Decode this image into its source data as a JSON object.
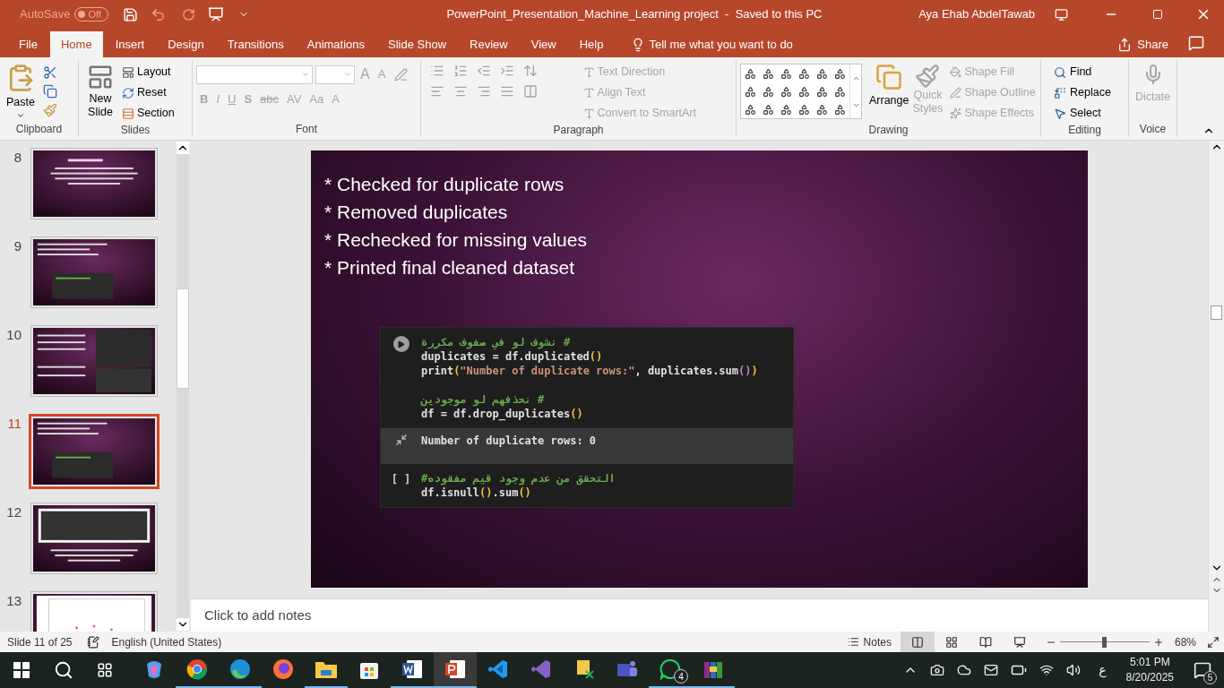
{
  "title_bar": {
    "autosave_label": "AutoSave",
    "autosave_toggle": {
      "label": "Off",
      "on": false
    },
    "title": "PowerPoint_Presentation_Machine_Learning project  -  Saved to this PC",
    "user": "Aya Ehab AbdelTawab"
  },
  "tabs": [
    {
      "label": "File",
      "selected": false
    },
    {
      "label": "Home",
      "selected": true
    },
    {
      "label": "Insert",
      "selected": false
    },
    {
      "label": "Design",
      "selected": false
    },
    {
      "label": "Transitions",
      "selected": false
    },
    {
      "label": "Animations",
      "selected": false
    },
    {
      "label": "Slide Show",
      "selected": false
    },
    {
      "label": "Review",
      "selected": false
    },
    {
      "label": "View",
      "selected": false
    },
    {
      "label": "Help",
      "selected": false
    }
  ],
  "tell_me": "Tell me what you want to do",
  "share": "Share",
  "ribbon": {
    "clipboard": {
      "label": "Clipboard",
      "paste": "Paste"
    },
    "slides": {
      "label": "Slides",
      "new_slide": "New Slide",
      "items": [
        "Layout",
        "Reset",
        "Section"
      ]
    },
    "font": {
      "label": "Font",
      "row1": [
        {
          "glyph": "A",
          "kind": "grow"
        },
        {
          "glyph": "A",
          "kind": "shrink"
        }
      ],
      "row2": [
        {
          "glyph": "B",
          "kind": "bold"
        },
        {
          "glyph": "I",
          "kind": "italic"
        },
        {
          "glyph": "U",
          "kind": "underline"
        },
        {
          "glyph": "S",
          "kind": "shadow"
        },
        {
          "glyph": "abc",
          "kind": "strike"
        },
        {
          "glyph": "AV",
          "kind": "spacing"
        },
        {
          "glyph": "Aa",
          "kind": "case"
        },
        {
          "glyph": "A",
          "kind": "color"
        }
      ],
      "disabled": true
    },
    "paragraph": {
      "label": "Paragraph",
      "items": [
        {
          "label": "Text Direction",
          "disabled": true
        },
        {
          "label": "Align Text",
          "disabled": true
        },
        {
          "label": "Convert to SmartArt",
          "disabled": true
        }
      ]
    },
    "drawing": {
      "label": "Drawing",
      "arrange": "Arrange",
      "quick_styles": {
        "label": "Quick Styles",
        "disabled": true
      },
      "items": [
        {
          "label": "Shape Fill",
          "disabled": true
        },
        {
          "label": "Shape Outline",
          "disabled": true
        },
        {
          "label": "Shape Effects",
          "disabled": true
        }
      ]
    },
    "editing": {
      "label": "Editing",
      "items": [
        {
          "label": "Find",
          "kind": "find"
        },
        {
          "label": "Replace",
          "kind": "replace"
        },
        {
          "label": "Select",
          "kind": "select"
        }
      ]
    },
    "voice": {
      "label": "Voice",
      "dictate": {
        "label": "Dictate",
        "disabled": true
      }
    }
  },
  "thumbnails": [
    {
      "number": "8",
      "selected": false,
      "kind": "text"
    },
    {
      "number": "9",
      "selected": false,
      "kind": "code"
    },
    {
      "number": "10",
      "selected": false,
      "kind": "split"
    },
    {
      "number": "11",
      "selected": true,
      "kind": "code"
    },
    {
      "number": "12",
      "selected": false
    },
    {
      "number": "13",
      "selected": false,
      "kind": "chart"
    }
  ],
  "slide": {
    "bullets": [
      "* Checked for duplicate rows",
      "* Removed duplicates",
      "* Rechecked for missing values",
      "* Printed final cleaned dataset"
    ],
    "cells": [
      {
        "kind": "run",
        "blocks": [
          [
            {
              "rtl": true,
              "tokens": [
                {
                  "kind": "comment",
                  "t": "# نشوف لو في صفوف مكررة"
                }
              ]
            },
            {
              "tokens": [
                {
                  "kind": "plain",
                  "t": "duplicates = df.duplicated"
                },
                {
                  "kind": "paren",
                  "t": "()"
                }
              ]
            },
            {
              "tokens": [
                {
                  "kind": "plain",
                  "t": "print"
                },
                {
                  "kind": "paren",
                  "t": "("
                },
                {
                  "kind": "string",
                  "t": "\"Number of duplicate rows:\""
                },
                {
                  "kind": "plain",
                  "t": ", duplicates.sum"
                },
                {
                  "kind": "paren2",
                  "t": "()"
                },
                {
                  "kind": "paren",
                  "t": ")"
                }
              ]
            }
          ],
          [
            {
              "rtl": true,
              "tokens": [
                {
                  "kind": "comment",
                  "t": "# نحذفهم لو موجودين"
                }
              ]
            },
            {
              "tokens": [
                {
                  "kind": "plain",
                  "t": "df = df.drop_duplicates"
                },
                {
                  "kind": "paren",
                  "t": "()"
                }
              ]
            }
          ]
        ],
        "output": "Number of duplicate rows: 0"
      },
      {
        "kind": "idle",
        "marker": "[ ]",
        "blocks": [
          [
            {
              "rtl": false,
              "tokens": [
                {
                  "kind": "comment",
                  "t": "#التحقق من عدم وجود قيم مفقوده"
                }
              ]
            },
            {
              "tokens": [
                {
                  "kind": "plain",
                  "t": "df.isnull"
                },
                {
                  "kind": "paren",
                  "t": "()"
                },
                {
                  "kind": "plain",
                  "t": ".sum"
                },
                {
                  "kind": "paren",
                  "t": "()"
                }
              ]
            }
          ]
        ]
      }
    ]
  },
  "notes_placeholder": "Click to add notes",
  "status_bar": {
    "slide_count": "Slide 11 of 25",
    "language": "English (United States)",
    "notes": "Notes",
    "views": [
      {
        "kind": "normal",
        "selected": true
      },
      {
        "kind": "sorter",
        "selected": false
      },
      {
        "kind": "reading",
        "selected": false
      },
      {
        "kind": "show",
        "selected": false
      }
    ],
    "zoom": {
      "level": 0.5,
      "reading": "68%"
    }
  },
  "taskbar": {
    "apps": [
      {
        "kind": "copilot",
        "running": false,
        "active": false
      },
      {
        "kind": "chrome",
        "running": true,
        "active": false
      },
      {
        "kind": "edge",
        "running": true,
        "active": false
      },
      {
        "kind": "firefox",
        "running": false,
        "active": false
      },
      {
        "kind": "explorer",
        "running": true,
        "active": false
      },
      {
        "kind": "store",
        "running": false,
        "active": false
      },
      {
        "kind": "word",
        "running": true,
        "active": false
      },
      {
        "kind": "powerpoint",
        "running": true,
        "active": true
      },
      {
        "kind": "vscode",
        "running": false,
        "active": false
      },
      {
        "kind": "vs",
        "running": false,
        "active": false
      },
      {
        "kind": "tool",
        "running": false,
        "active": false
      },
      {
        "kind": "teams",
        "running": false,
        "active": false
      },
      {
        "kind": "whatsapp",
        "running": true,
        "active": false,
        "badge": "4"
      },
      {
        "kind": "archive",
        "running": true,
        "active": false
      }
    ],
    "input_language": "ع",
    "time": "5:01 PM",
    "date": "8/20/2025",
    "notification_count": "5"
  }
}
